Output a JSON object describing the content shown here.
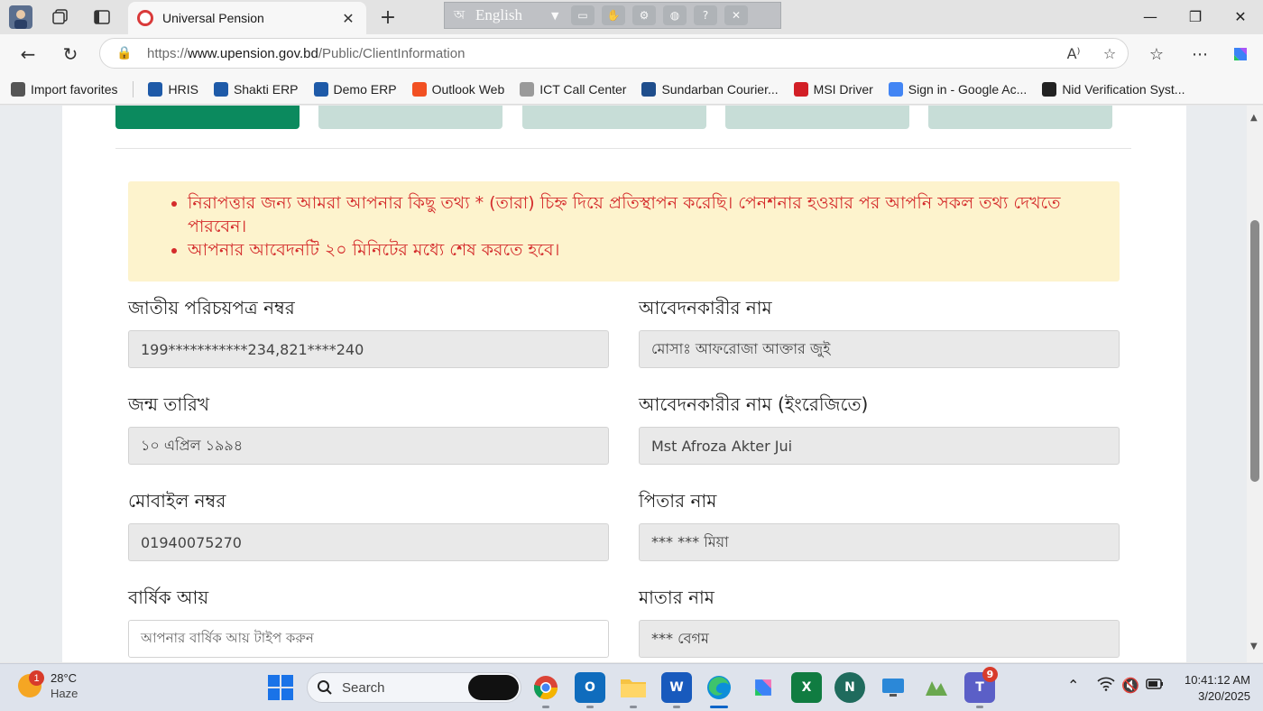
{
  "browser": {
    "tab_title": "Universal Pension",
    "tab_close": "✕",
    "new_tab": "+",
    "url_prefix": "https://",
    "url_host": "www.upension.gov.bd",
    "url_path": "/Public/ClientInformation",
    "ime_language": "English"
  },
  "bookmarks": [
    {
      "label": "Import favorites",
      "icon": "import-icon",
      "color": "#555555"
    },
    {
      "label": "HRIS",
      "icon": "shakti-icon",
      "color": "#1e5aa8"
    },
    {
      "label": "Shakti ERP",
      "icon": "shakti-icon",
      "color": "#1e5aa8"
    },
    {
      "label": "Demo ERP",
      "icon": "shakti-icon",
      "color": "#1e5aa8"
    },
    {
      "label": "Outlook Web",
      "icon": "windows-logo-icon",
      "color": "#f25022"
    },
    {
      "label": "ICT Call Center",
      "icon": "broken-image-icon",
      "color": "#9a9a9a"
    },
    {
      "label": "Sundarban Courier...",
      "icon": "courier-icon",
      "color": "#1f4e8c"
    },
    {
      "label": "MSI Driver",
      "icon": "msi-shield-icon",
      "color": "#d21f26"
    },
    {
      "label": "Sign in - Google Ac...",
      "icon": "google-icon",
      "color": "#4285f4"
    },
    {
      "label": "Nid Verification Syst...",
      "icon": "angular-icon",
      "color": "#222222"
    }
  ],
  "alert": {
    "items": [
      "নিরাপত্তার জন্য আমরা আপনার কিছু তথ্য * (তারা) চিহ্ন দিয়ে প্রতিস্থাপন করেছি। পেনশনার হওয়ার পর আপনি সকল তথ্য দেখতে পারবেন।",
      "আপনার আবেদনটি ২০ মিনিটের মধ্যে শেষ করতে হবে।"
    ]
  },
  "form": {
    "nid": {
      "label": "জাতীয় পরিচয়পত্র নম্বর",
      "value": "199***********234,821****240"
    },
    "applicant_name": {
      "label": "আবেদনকারীর নাম",
      "value": "মোসাঃ আফরোজা আক্তার জুই"
    },
    "dob": {
      "label": "জন্ম তারিখ",
      "value": "১০ এপ্রিল ১৯৯৪"
    },
    "applicant_name_en": {
      "label": "আবেদনকারীর নাম (ইংরেজিতে)",
      "value": "Mst Afroza Akter Jui"
    },
    "mobile": {
      "label": "মোবাইল নম্বর",
      "value": "01940075270"
    },
    "father_name": {
      "label": "পিতার নাম",
      "value": "*** *** মিয়া"
    },
    "annual_income": {
      "label": "বার্ষিক আয়",
      "placeholder": "আপনার বার্ষিক আয় টাইপ করুন"
    },
    "mother_name": {
      "label": "মাতার নাম",
      "value": "*** বেগম"
    }
  },
  "taskbar": {
    "weather_temp": "28°C",
    "weather_desc": "Haze",
    "weather_badge": "1",
    "search_label": "Search",
    "teams_badge": "9",
    "time": "10:41:12 AM",
    "date": "3/20/2025"
  },
  "colors": {
    "accent_green": "#0b8a5e",
    "step_inactive": "#c7ddd7",
    "alert_bg": "#fdf3cd",
    "alert_text": "#d42b2b"
  }
}
